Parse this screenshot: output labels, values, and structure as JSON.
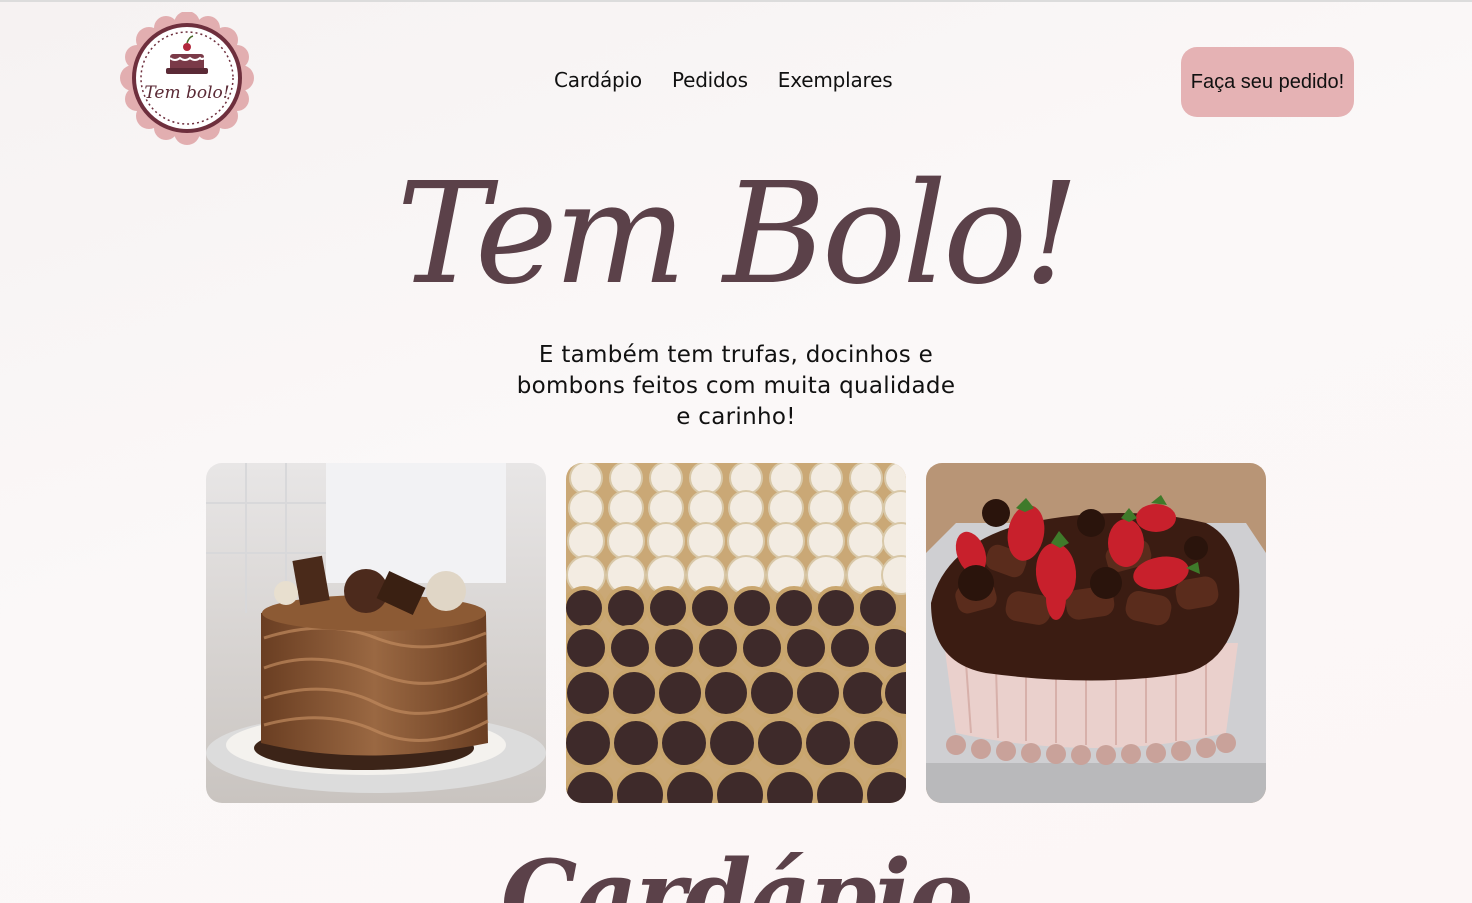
{
  "brand": {
    "logo_text": "Tem bolo!"
  },
  "nav": {
    "items": [
      {
        "label": "Cardápio"
      },
      {
        "label": "Pedidos"
      },
      {
        "label": "Exemplares"
      }
    ]
  },
  "cta": {
    "label": "Faça seu pedido!"
  },
  "hero": {
    "title": "Tem Bolo!",
    "subtitle": "E também tem trufas, docinhos e bombons feitos com muita qualidade e carinho!"
  },
  "gallery": {
    "photos": [
      {
        "name": "chocolate-cake-photo"
      },
      {
        "name": "truffles-brigadeiros-photo"
      },
      {
        "name": "strawberry-chocolate-cake-photo"
      }
    ]
  },
  "section": {
    "title": "Cardápio"
  },
  "colors": {
    "accent": "#e5b2b4",
    "brand_text": "#5b4149",
    "background": "#f8f4f4"
  }
}
